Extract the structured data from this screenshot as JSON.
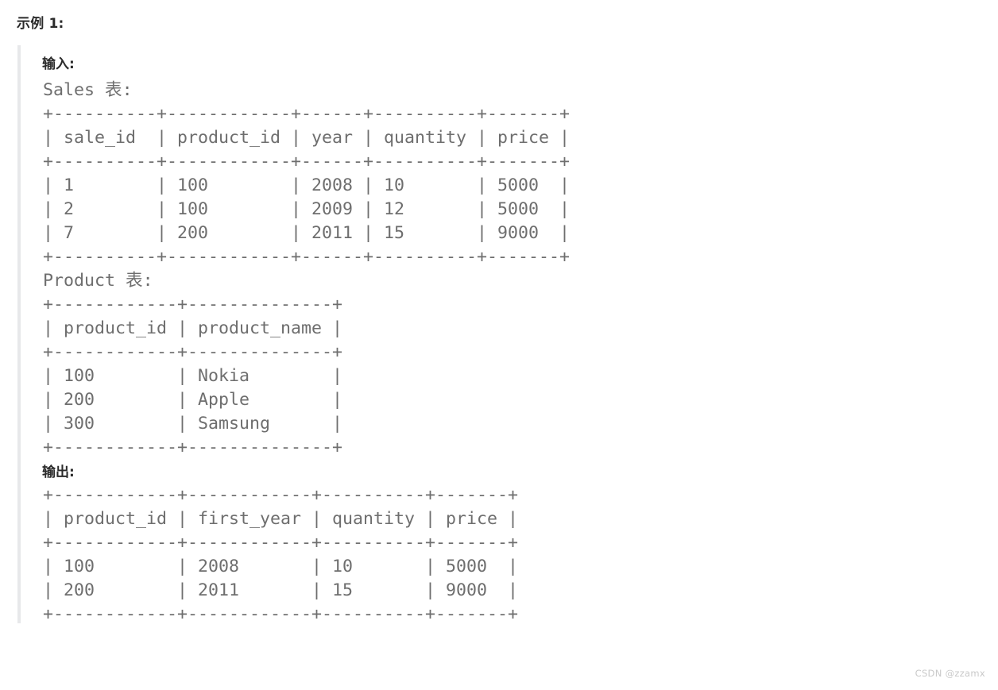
{
  "page": {
    "heading": "示例 1:",
    "background_color": "#ffffff",
    "mono_text_color": "#6e6e6e",
    "heading_text_color": "#2b2b2b",
    "blockquote_border_color": "#e7e8ea"
  },
  "example": {
    "input_label": "输入:",
    "output_label": "输出:",
    "sales_caption": "Sales 表:",
    "product_caption": "Product 表:",
    "sales_table_text": "+----------+------------+------+----------+-------+\n| sale_id  | product_id | year | quantity | price |\n+----------+------------+------+----------+-------+\n| 1        | 100        | 2008 | 10       | 5000  |\n| 2        | 100        | 2009 | 12       | 5000  |\n| 7        | 200        | 2011 | 15       | 9000  |\n+----------+------------+------+----------+-------+",
    "product_table_text": "+------------+--------------+\n| product_id | product_name |\n+------------+--------------+\n| 100        | Nokia        |\n| 200        | Apple        |\n| 300        | Samsung      |\n+------------+--------------+",
    "output_table_text": "+------------+------------+----------+-------+\n| product_id | first_year | quantity | price |\n+------------+------------+----------+-------+\n| 100        | 2008       | 10       | 5000  |\n| 200        | 2011       | 15       | 9000  |\n+------------+------------+----------+-------+"
  },
  "tables": {
    "sales": {
      "name": "Sales",
      "columns": [
        "sale_id",
        "product_id",
        "year",
        "quantity",
        "price"
      ],
      "rows": [
        [
          "1",
          "100",
          "2008",
          "10",
          "5000"
        ],
        [
          "2",
          "100",
          "2009",
          "12",
          "5000"
        ],
        [
          "7",
          "200",
          "2011",
          "15",
          "9000"
        ]
      ]
    },
    "product": {
      "name": "Product",
      "columns": [
        "product_id",
        "product_name"
      ],
      "rows": [
        [
          "100",
          "Nokia"
        ],
        [
          "200",
          "Apple"
        ],
        [
          "300",
          "Samsung"
        ]
      ]
    },
    "output": {
      "columns": [
        "product_id",
        "first_year",
        "quantity",
        "price"
      ],
      "rows": [
        [
          "100",
          "2008",
          "10",
          "5000"
        ],
        [
          "200",
          "2011",
          "15",
          "9000"
        ]
      ]
    }
  },
  "watermark": {
    "text": "CSDN @zzamx"
  }
}
